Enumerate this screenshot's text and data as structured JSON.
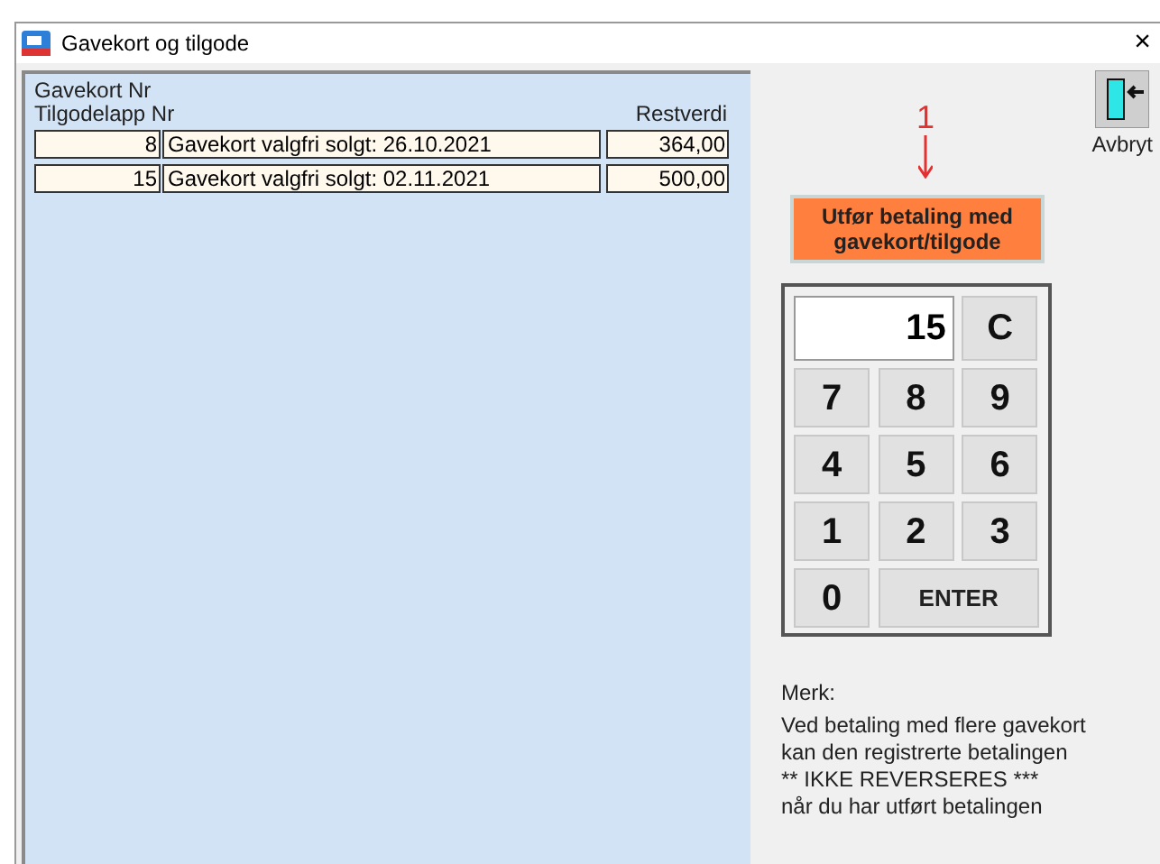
{
  "window": {
    "title": "Gavekort og tilgode",
    "close": "×"
  },
  "list": {
    "header_lines": [
      "Gavekort Nr",
      "Tilgodelapp Nr"
    ],
    "value_header": "Restverdi",
    "rows": [
      {
        "number": "8",
        "description": "Gavekort valgfri solgt: 26.10.2021",
        "value": "364,00"
      },
      {
        "number": "15",
        "description": "Gavekort valgfri solgt: 02.11.2021",
        "value": "500,00"
      }
    ]
  },
  "cancel_button": {
    "label": "Avbryt"
  },
  "annotation": {
    "label": "1"
  },
  "pay_button": {
    "label": "Utfør betaling med gavekort/tilgode"
  },
  "keypad": {
    "display": "15",
    "clear": "C",
    "keys": [
      "7",
      "8",
      "9",
      "4",
      "5",
      "6",
      "1",
      "2",
      "3"
    ],
    "zero": "0",
    "enter": "ENTER"
  },
  "note": {
    "title": "Merk:",
    "lines": [
      "Ved betaling med flere gavekort",
      "kan den registrerte betalingen",
      "** IKKE REVERSERES ***",
      "når du har utført betalingen"
    ]
  }
}
